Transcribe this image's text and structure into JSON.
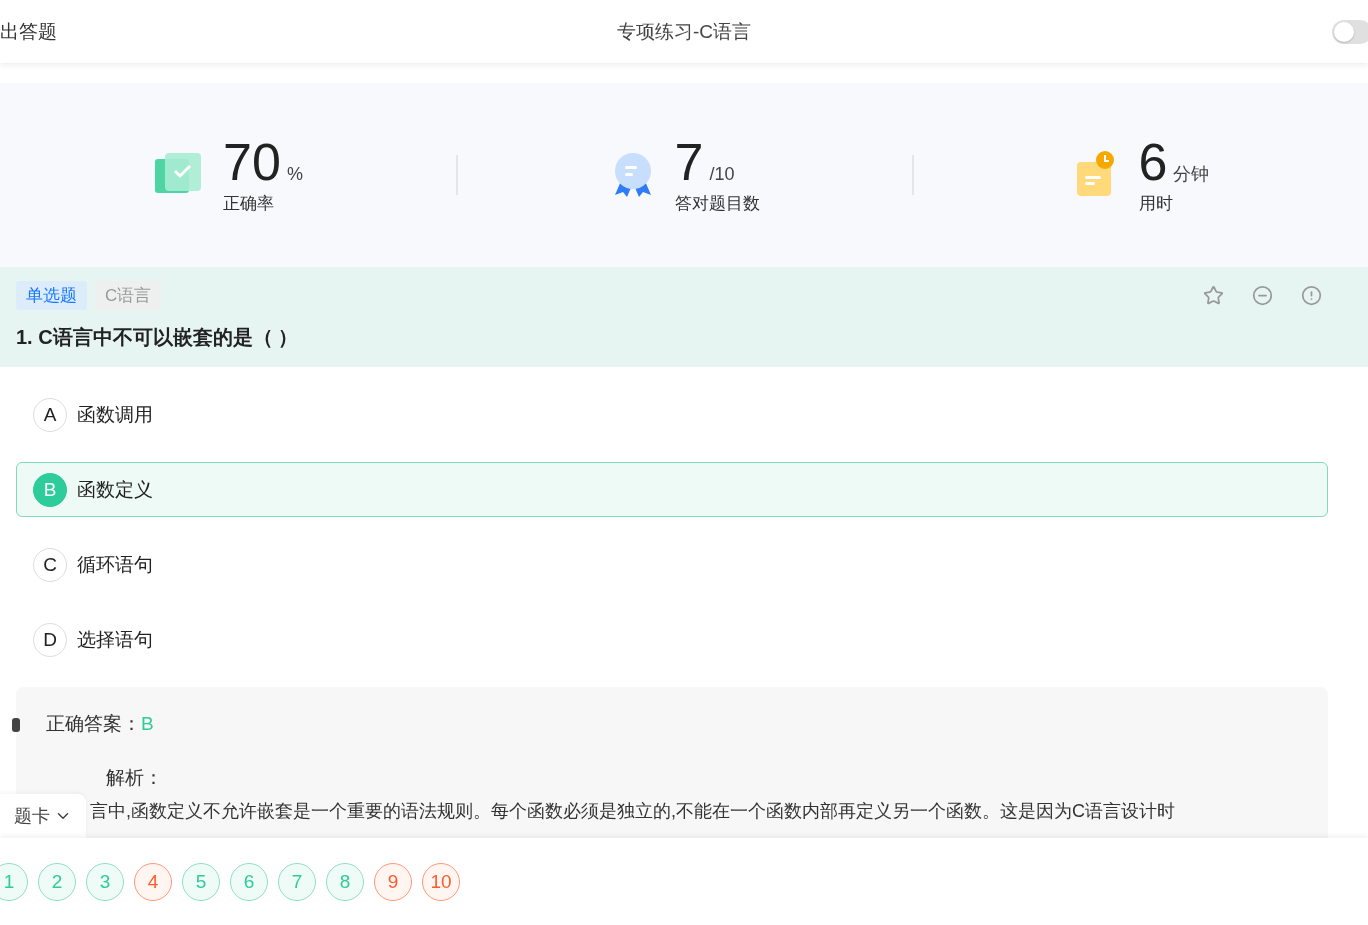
{
  "header": {
    "exit": "出答题",
    "title": "专项练习-C语言",
    "toggle": {
      "on": false
    }
  },
  "stats": [
    {
      "kind": "accuracy",
      "value": "70",
      "unit": "%",
      "label": "正确率"
    },
    {
      "kind": "correct",
      "value": "7",
      "unit": "/10",
      "label": "答对题目数"
    },
    {
      "kind": "time",
      "value": "6",
      "unit": "分钟",
      "label": "用时"
    }
  ],
  "question": {
    "type_tag": "单选题",
    "subject_tag": "C语言",
    "text": "1. C语言中不可以嵌套的是（ ）",
    "options": [
      {
        "letter": "A",
        "text": "函数调用",
        "selected": false
      },
      {
        "letter": "B",
        "text": "函数定义",
        "selected": true
      },
      {
        "letter": "C",
        "text": "循环语句",
        "selected": false
      },
      {
        "letter": "D",
        "text": "选择语句",
        "selected": false
      }
    ]
  },
  "analysis": {
    "answer_label": "正确答案：",
    "answer": "B",
    "explanation_label": "解析：",
    "explanation": "言中,函数定义不允许嵌套是一个重要的语法规则。每个函数必须是独立的,不能在一个函数内部再定义另一个函数。这是因为C语言设计时"
  },
  "answer_card": {
    "label": "题卡",
    "items": [
      {
        "number": "1",
        "kind": "correct"
      },
      {
        "number": "2",
        "kind": "correct"
      },
      {
        "number": "3",
        "kind": "correct"
      },
      {
        "number": "4",
        "kind": "wrong"
      },
      {
        "number": "5",
        "kind": "correct"
      },
      {
        "number": "6",
        "kind": "correct"
      },
      {
        "number": "7",
        "kind": "correct"
      },
      {
        "number": "8",
        "kind": "correct"
      },
      {
        "number": "9",
        "kind": "wrong"
      },
      {
        "number": "10",
        "kind": "wrong"
      }
    ]
  }
}
